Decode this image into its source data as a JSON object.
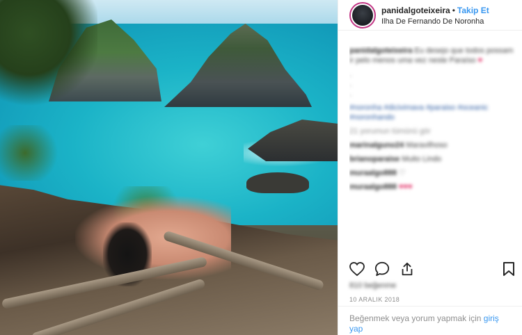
{
  "post": {
    "username": "panidalgoteixeira",
    "separator": "•",
    "follow_label": "Takip Et",
    "location": "Ilha De Fernando De Noronha",
    "caption_user": "panidalgoteixeira",
    "caption_text": "Eu desejo que todos possam ir pelo menos uma vez neste Paraíso",
    "caption_heart": "♥",
    "caption_dots": [
      ".",
      ".",
      "."
    ],
    "hashtags": "#noronha #dicivimava #paraiso #oceanic #noronhando",
    "view_comments": "21 yorumun tümünü gör",
    "comments": [
      {
        "user": "marinalguno24",
        "text": "Maravilhoso"
      },
      {
        "user": "brianoparaise",
        "text": "Muito Lindo"
      },
      {
        "user": "muraalgo888",
        "text": "♡"
      },
      {
        "user": "muraalgo888",
        "text": "♥♥♥"
      }
    ],
    "likes": "810 beğenme",
    "date": "10 ARALIK 2018",
    "footer_text": "Beğenmek veya yorum yapmak için",
    "login_label": "giriş yap"
  },
  "icons": {
    "like": "heart-outline-icon",
    "comment": "speech-bubble-icon",
    "share": "share-icon",
    "save": "bookmark-icon"
  },
  "colors": {
    "accent": "#3897f0",
    "text": "#262626",
    "muted": "#8e8e8e",
    "border": "#efefef"
  }
}
